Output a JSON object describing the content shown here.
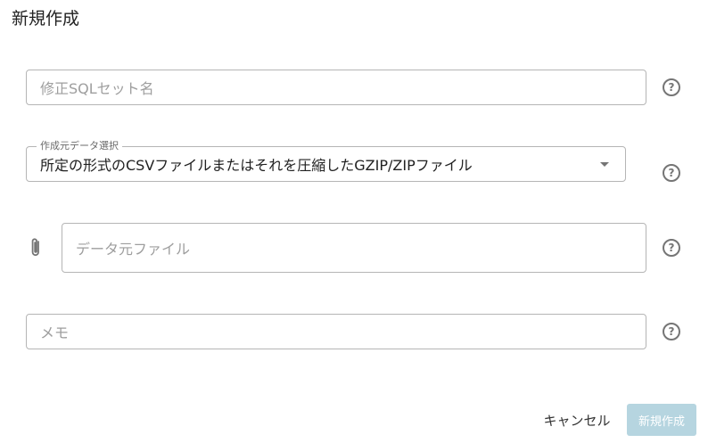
{
  "dialog": {
    "title": "新規作成"
  },
  "fields": {
    "sql_set_name": {
      "placeholder": "修正SQLセット名"
    },
    "source_select": {
      "label": "作成元データ選択",
      "value": "所定の形式のCSVファイルまたはそれを圧縮したGZIP/ZIPファイル"
    },
    "source_file": {
      "placeholder": "データ元ファイル"
    },
    "memo": {
      "placeholder": "メモ"
    }
  },
  "icons": {
    "help": "?",
    "attach": "paperclip-icon",
    "dropdown": "arrow-drop-down-icon"
  },
  "actions": {
    "cancel_label": "キャンセル",
    "create_label": "新規作成"
  },
  "colors": {
    "create_button_disabled": "#b6d5e0",
    "border": "#b5b5b5",
    "icon": "#757575"
  }
}
